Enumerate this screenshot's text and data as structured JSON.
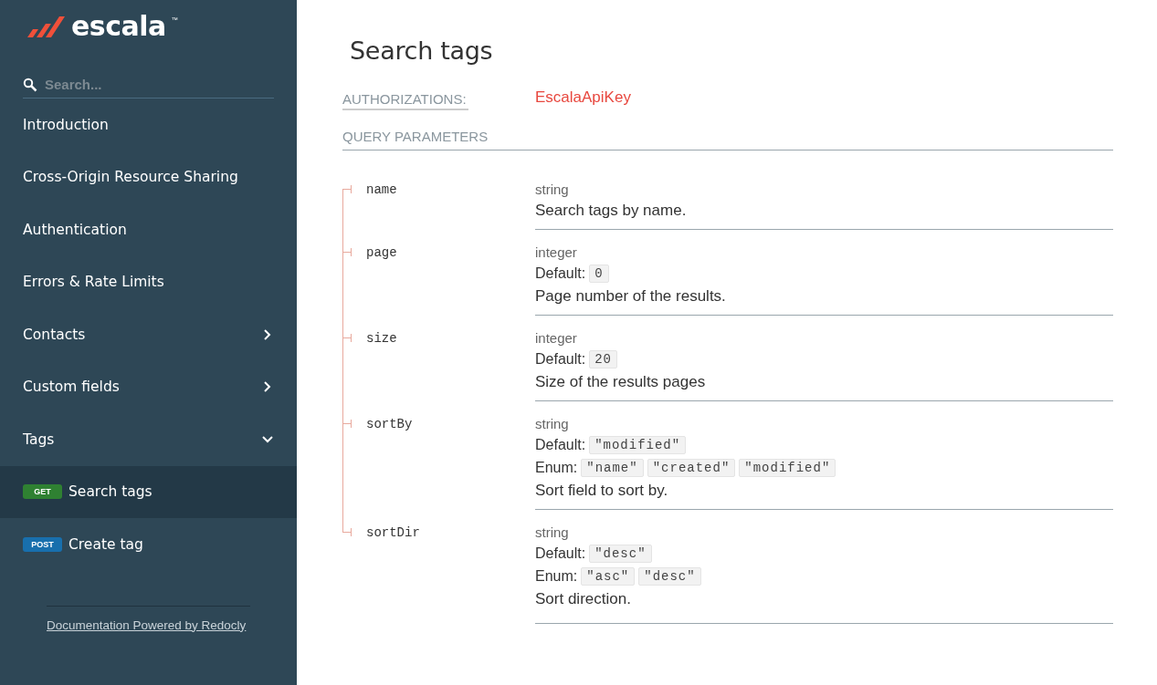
{
  "sidebar": {
    "logo": {
      "text": "escala",
      "trademark": "™"
    },
    "search": {
      "placeholder": "Search..."
    },
    "items": [
      {
        "kind": "page",
        "label": "Introduction",
        "selected": false
      },
      {
        "kind": "page",
        "label": "Cross-Origin Resource Sharing",
        "selected": false
      },
      {
        "kind": "page",
        "label": "Authentication",
        "selected": false
      },
      {
        "kind": "page",
        "label": "Errors & Rate Limits",
        "selected": false
      },
      {
        "kind": "group",
        "label": "Contacts",
        "selected": false,
        "expanded": false
      },
      {
        "kind": "group",
        "label": "Custom fields",
        "selected": false,
        "expanded": false
      },
      {
        "kind": "group",
        "label": "Tags",
        "selected": false,
        "expanded": true,
        "children": [
          {
            "kind": "operation",
            "method": "GET",
            "label": "Search tags",
            "selected": true
          },
          {
            "kind": "operation",
            "method": "POST",
            "label": "Create tag",
            "selected": false
          }
        ]
      }
    ],
    "footer_link": "Documentation Powered by Redocly"
  },
  "main": {
    "title": "Search tags",
    "authorizations": {
      "label": "AUTHORIZATIONS:",
      "value": "EscalaApiKey"
    },
    "query_parameters": {
      "heading": "QUERY PARAMETERS",
      "params": [
        {
          "name": "name",
          "type": "string",
          "description": "Search tags by name."
        },
        {
          "name": "page",
          "type": "integer",
          "default": {
            "label": "Default:",
            "value": "0"
          },
          "description": "Page number of the results."
        },
        {
          "name": "size",
          "type": "integer",
          "default": {
            "label": "Default:",
            "value": "20"
          },
          "description": "Size of the results pages"
        },
        {
          "name": "sortBy",
          "type": "string",
          "default": {
            "label": "Default:",
            "value": "\"modified\""
          },
          "enum": {
            "label": "Enum:",
            "values": [
              "\"name\"",
              "\"created\"",
              "\"modified\""
            ]
          },
          "description": "Sort field to sort by."
        },
        {
          "name": "sortDir",
          "type": "string",
          "default": {
            "label": "Default:",
            "value": "\"desc\""
          },
          "enum": {
            "label": "Enum:",
            "values": [
              "\"asc\"",
              "\"desc\""
            ]
          },
          "description": "Sort direction."
        }
      ]
    }
  }
}
